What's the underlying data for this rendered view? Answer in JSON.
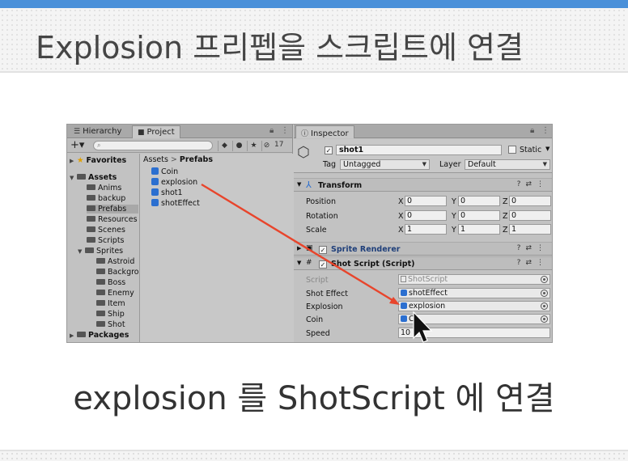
{
  "slide": {
    "title": "Explosion 프리펩을 스크립트에 연결",
    "caption": "explosion 를 ShotScript 에 연결"
  },
  "project_panel": {
    "tabs": [
      {
        "label": "Hierarchy",
        "icon": "list-icon"
      },
      {
        "label": "Project",
        "icon": "folder-icon"
      }
    ],
    "hidden_count": "17",
    "search_placeholder": "",
    "tree": [
      {
        "label": "Favorites",
        "type": "favorites",
        "bold": true
      },
      {
        "label": "Assets",
        "type": "folder",
        "bold": true
      },
      {
        "label": "Anims",
        "type": "folder"
      },
      {
        "label": "backup",
        "type": "folder"
      },
      {
        "label": "Prefabs",
        "type": "folder",
        "selected": true
      },
      {
        "label": "Resources",
        "type": "folder"
      },
      {
        "label": "Scenes",
        "type": "folder"
      },
      {
        "label": "Scripts",
        "type": "folder"
      },
      {
        "label": "Sprites",
        "type": "folder"
      },
      {
        "label": "Astroid",
        "type": "folder"
      },
      {
        "label": "Backgro",
        "type": "folder"
      },
      {
        "label": "Boss",
        "type": "folder"
      },
      {
        "label": "Enemy",
        "type": "folder"
      },
      {
        "label": "Item",
        "type": "folder"
      },
      {
        "label": "Ship",
        "type": "folder"
      },
      {
        "label": "Shot",
        "type": "folder"
      },
      {
        "label": "Packages",
        "type": "folder",
        "bold": true
      }
    ],
    "breadcrumb": [
      "Assets",
      "Prefabs"
    ],
    "assets": [
      "Coin",
      "explosion",
      "shot1",
      "shotEffect"
    ]
  },
  "inspector": {
    "tab_label": "Inspector",
    "object_name": "shot1",
    "static_label": "Static",
    "tag_label": "Tag",
    "tag_value": "Untagged",
    "layer_label": "Layer",
    "layer_value": "Default",
    "transform": {
      "title": "Transform",
      "rows": [
        {
          "label": "Position",
          "x": "0",
          "y": "0",
          "z": "0"
        },
        {
          "label": "Rotation",
          "x": "0",
          "y": "0",
          "z": "0"
        },
        {
          "label": "Scale",
          "x": "1",
          "y": "1",
          "z": "1"
        }
      ],
      "axis_labels": [
        "X",
        "Y",
        "Z"
      ]
    },
    "sprite_renderer": {
      "title": "Sprite Renderer"
    },
    "shot_script": {
      "title": "Shot Script (Script)",
      "script_label": "Script",
      "script_value": "ShotScript",
      "shot_effect_label": "Shot Effect",
      "shot_effect_value": "shotEffect",
      "explosion_label": "Explosion",
      "explosion_value": "explosion",
      "coin_label": "Coin",
      "coin_value": "C",
      "speed_label": "Speed",
      "speed_value": "10"
    }
  },
  "colors": {
    "accent_bar": "#4a90d9",
    "arrow": "#e8452c",
    "prefab_cube": "#2b6fd0",
    "sprite_renderer_title": "#1f3f7a"
  }
}
